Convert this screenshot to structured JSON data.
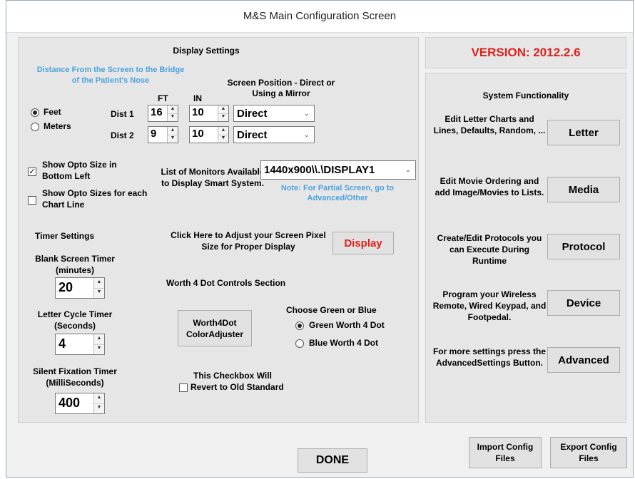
{
  "window": {
    "title": "M&S Main Configuration Screen"
  },
  "display": {
    "heading": "Display Settings",
    "distance_label": "Distance From the Screen to the Bridge of the Patient's Nose",
    "screen_position_label": "Screen Position - Direct or Using a Mirror",
    "unit_feet": "Feet",
    "unit_meters": "Meters",
    "col_ft": "FT",
    "col_in": "IN",
    "dist1_label": "Dist 1",
    "dist2_label": "Dist 2",
    "dist1_ft": "16",
    "dist1_in": "10",
    "dist1_position": "Direct",
    "dist2_ft": "9",
    "dist2_in": "10",
    "dist2_position": "Direct",
    "show_opto_bottom_left": "Show Opto Size in Bottom Left",
    "show_opto_each_line": "Show Opto Sizes for each Chart Line",
    "monitors_label": "List of Monitors Available to Display Smart System.",
    "monitor_selected": "1440x900\\\\.\\DISPLAY1",
    "monitor_note": "Note: For Partial Screen, go to Advanced/Other",
    "timer_heading": "Timer Settings",
    "blank_timer_label": "Blank Screen Timer (minutes)",
    "blank_timer_value": "20",
    "letter_timer_label": "Letter Cycle Timer (Seconds)",
    "letter_timer_value": "4",
    "silent_timer_label": "Silent Fixation Timer (MilliSeconds)",
    "silent_timer_value": "400",
    "pixel_size_label": "Click Here to Adjust your Screen Pixel Size for Proper Display",
    "display_button": "Display",
    "w4d_heading": "Worth 4 Dot Controls Section",
    "w4d_adjuster_button": "Worth4Dot ColorAdjuster",
    "w4d_choose_label": "Choose Green or Blue",
    "w4d_green": "Green Worth 4 Dot",
    "w4d_blue": "Blue Worth 4 Dot",
    "old_standard_label": "This Checkbox Will",
    "old_standard_check": "Revert to Old Standard"
  },
  "version": {
    "text": "VERSION: 2012.2.6",
    "color": "#e0201c"
  },
  "system": {
    "heading": "System Functionality",
    "items": [
      {
        "desc": "Edit Letter Charts and Lines, Defaults, Random, ...",
        "button": "Letter"
      },
      {
        "desc": "Edit Movie Ordering and add Image/Movies to Lists.",
        "button": "Media"
      },
      {
        "desc": "Create/Edit Protocols you can Execute During Runtime",
        "button": "Protocol"
      },
      {
        "desc": "Program your Wireless Remote, Wired Keypad, and Footpedal.",
        "button": "Device"
      },
      {
        "desc": "For more settings press the AdvancedSettings Button.",
        "button": "Advanced"
      }
    ]
  },
  "footer": {
    "done": "DONE",
    "import": "Import Config Files",
    "export": "Export Config Files"
  }
}
